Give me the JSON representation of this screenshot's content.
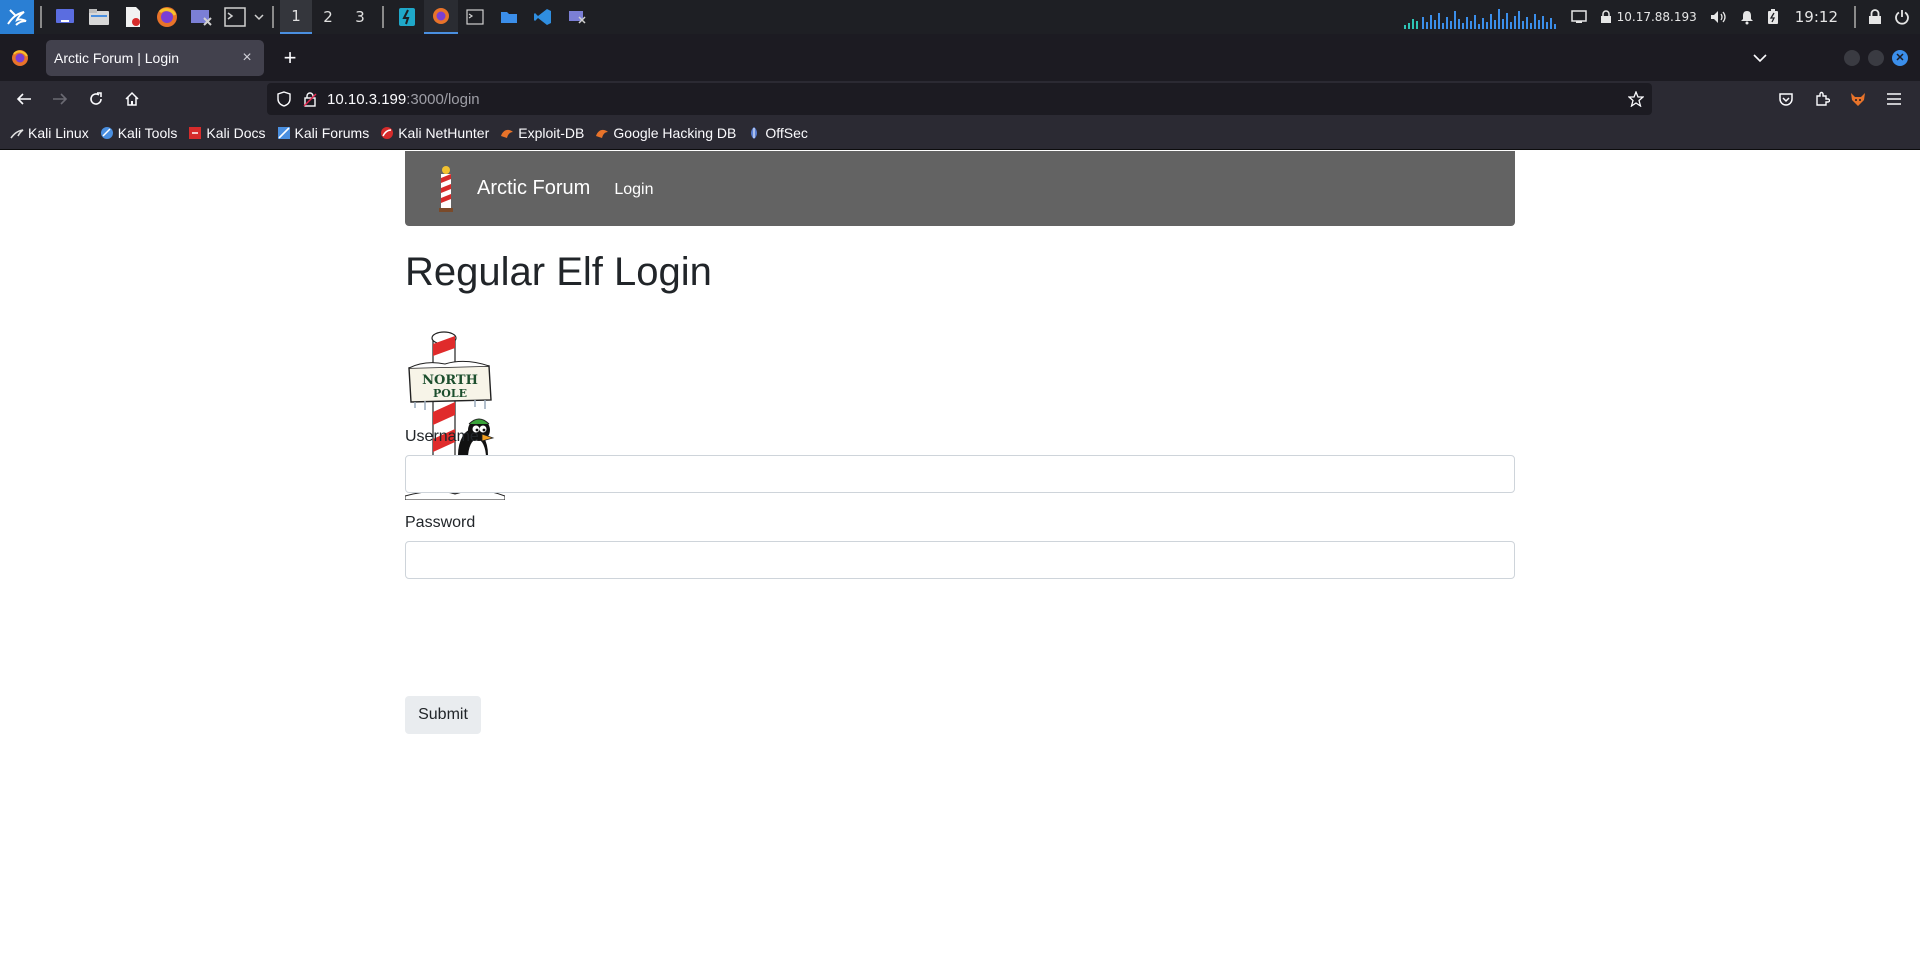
{
  "system_panel": {
    "workspaces": [
      "1",
      "2",
      "3"
    ],
    "active_workspace": "1",
    "ip_address": "10.17.88.193",
    "clock": "19:12",
    "launchers": [
      "kali-menu-icon",
      "desktop-icon",
      "file-manager-icon",
      "text-editor-icon",
      "firefox-icon",
      "screenshot-icon",
      "terminal-icon"
    ],
    "tasks": [
      "burp-icon",
      "firefox-icon",
      "terminal-icon",
      "folder-icon",
      "vscode-icon",
      "screenshot-icon"
    ]
  },
  "browser": {
    "tab_title": "Arctic Forum | Login",
    "url_host": "10.10.3.199",
    "url_path": ":3000/login",
    "bookmarks": [
      {
        "label": "Kali Linux",
        "icon": "kali-icon",
        "color": "#e0e0e0"
      },
      {
        "label": "Kali Tools",
        "icon": "kali-tools-icon",
        "color": "#4a8fe0"
      },
      {
        "label": "Kali Docs",
        "icon": "kali-docs-icon",
        "color": "#d62b2b"
      },
      {
        "label": "Kali Forums",
        "icon": "kali-forums-icon",
        "color": "#4a8fe0"
      },
      {
        "label": "Kali NetHunter",
        "icon": "nethunter-icon",
        "color": "#d62b2b"
      },
      {
        "label": "Exploit-DB",
        "icon": "exploit-db-icon",
        "color": "#e8732a"
      },
      {
        "label": "Google Hacking DB",
        "icon": "ghdb-icon",
        "color": "#e8732a"
      },
      {
        "label": "OffSec",
        "icon": "offsec-icon",
        "color": "#5a7fd4"
      }
    ]
  },
  "site": {
    "brand": "Arctic Forum",
    "nav_login": "Login",
    "heading": "Regular Elf Login",
    "image_text_top": "NORTH",
    "image_text_bottom": "POLE",
    "username_label": "Username",
    "username_value": "",
    "password_label": "Password",
    "password_value": "",
    "submit_label": "Submit"
  },
  "colors": {
    "site_nav_bg": "#636363",
    "accent": "#4a8fe0"
  }
}
